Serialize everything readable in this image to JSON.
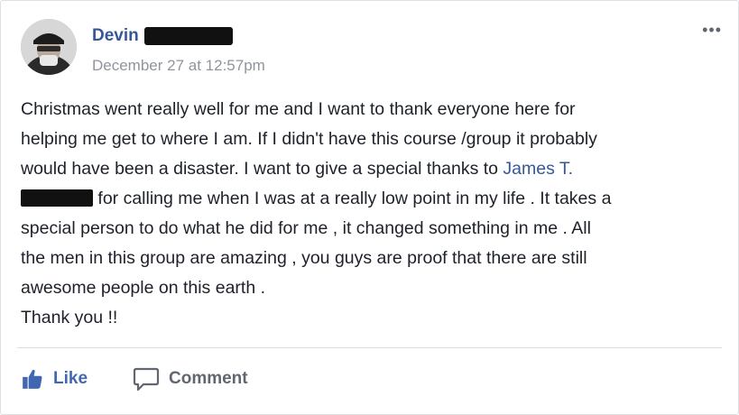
{
  "post": {
    "author": "Devin",
    "timestamp": "December 27 at 12:57pm",
    "more_label": "•••",
    "lines": [
      "Christmas went really well for me and I want to thank everyone here for",
      "helping me get to where I am. If I didn't have this course /group it probably",
      "would have been a disaster. I want to give a special thanks to "
    ],
    "mention": "James T.",
    "line4": " for calling me when I was at a really low point in my life . It takes a",
    "lines_after": [
      "special person to do what he did for me , it changed something in me . All",
      "the men in this group are amazing , you guys are proof that there are still",
      "awesome people on this earth .",
      "Thank you !!"
    ]
  },
  "actions": {
    "like_label": "Like",
    "comment_label": "Comment"
  },
  "icons": {
    "like": "thumbs-up-icon",
    "comment": "speech-bubble-icon",
    "more": "ellipsis-icon"
  },
  "colors": {
    "link": "#365899",
    "like": "#4267b2",
    "text": "#1d2129",
    "muted": "#90949c"
  }
}
